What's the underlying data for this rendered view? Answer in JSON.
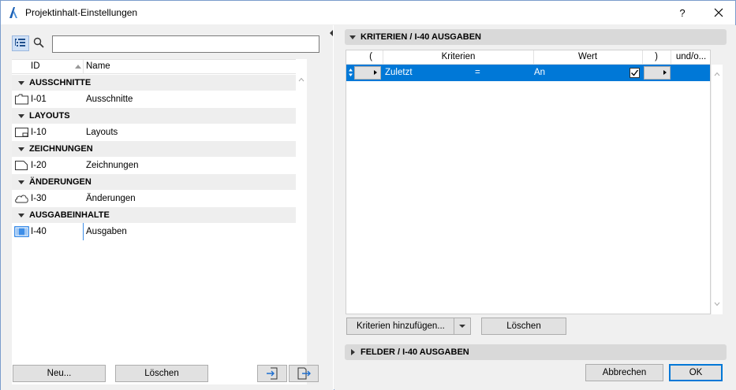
{
  "window": {
    "title": "Projektinhalt-Einstellungen",
    "help_label": "?",
    "accent_color": "#0078d7"
  },
  "left": {
    "search": {
      "value": "",
      "placeholder": ""
    },
    "columns": {
      "id": "ID",
      "name": "Name"
    },
    "groups": [
      {
        "label": "AUSSCHNITTE",
        "item": {
          "id": "I-01",
          "name": "Ausschnitte",
          "icon": "viewpoint-icon"
        }
      },
      {
        "label": "LAYOUTS",
        "item": {
          "id": "I-10",
          "name": "Layouts",
          "icon": "layout-icon"
        }
      },
      {
        "label": "ZEICHNUNGEN",
        "item": {
          "id": "I-20",
          "name": "Zeichnungen",
          "icon": "drawing-icon"
        }
      },
      {
        "label": "ÄNDERUNGEN",
        "item": {
          "id": "I-30",
          "name": "Änderungen",
          "icon": "cloud-icon"
        }
      },
      {
        "label": "AUSGABEINHALTE",
        "item": {
          "id": "I-40",
          "name": "Ausgaben",
          "icon": "output-icon",
          "selected": true
        }
      }
    ],
    "buttons": {
      "new": "Neu...",
      "delete": "Löschen"
    }
  },
  "right": {
    "criteria_header": "KRITERIEN / I-40 AUSGABEN",
    "fields_header": "FELDER / I-40 AUSGABEN",
    "columns": {
      "open_paren": "(",
      "criteria": "Kriterien",
      "value": "Wert",
      "close_paren": ")",
      "and_or": "und/o..."
    },
    "row": {
      "criteria": "Zuletzt",
      "operator": "=",
      "value": "An",
      "checked": true
    },
    "buttons": {
      "add_criteria": "Kriterien hinzufügen...",
      "delete": "Löschen"
    }
  },
  "footer": {
    "cancel": "Abbrechen",
    "ok": "OK"
  }
}
